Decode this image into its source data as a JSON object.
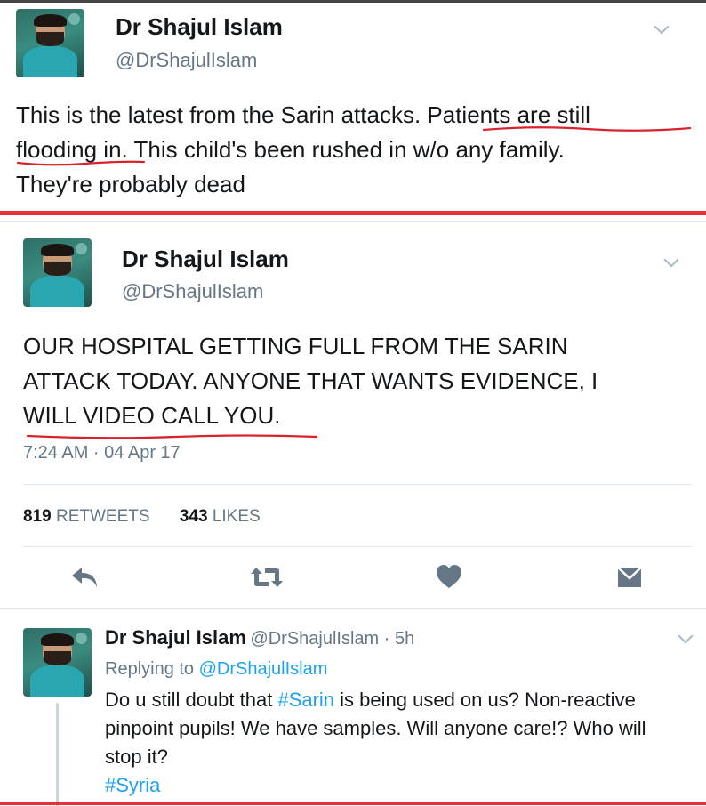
{
  "tweet1": {
    "name": "Dr Shajul Islam",
    "handle": "@DrShajulIslam",
    "text_plain_1": "This is the latest from the Sarin attacks.",
    "text_underlined": "Patients are still flooding in.",
    "text_plain_2": "This child's been rushed in w/o any family. They're probably dead",
    "line1_a": "This is the latest from the Sarin attacks. ",
    "line1_b": "Patients are still",
    "line2_a": "flooding in",
    "line2_b": ". This child's been rushed in w/o any family.",
    "line3": "They're probably dead"
  },
  "tweet2": {
    "name": "Dr Shajul Islam",
    "handle": "@DrShajulIslam",
    "line1": "OUR HOSPITAL GETTING FULL FROM THE SARIN",
    "line2": "ATTACK TODAY. ANYONE THAT WANTS EVIDENCE, I",
    "line3": "WILL VIDEO CALL YOU.",
    "timestamp": "7:24 AM · 04 Apr 17",
    "retweets_count": "819",
    "retweets_label": "RETWEETS",
    "likes_count": "343",
    "likes_label": "LIKES"
  },
  "tweet3": {
    "name": "Dr Shajul Islam",
    "handle_time": "@DrShajulIslam · 5h",
    "replying_label": "Replying to ",
    "replying_handle": "@DrShajulIslam",
    "line1_a": "Do u still doubt that ",
    "hashtag1": "#Sarin",
    "line1_b": " is being used on us? Non-reactive",
    "line2": "pinpoint pupils! We have samples. Will anyone care!? Who will",
    "line3": "stop it?",
    "hashtag2": "#Syria"
  },
  "colors": {
    "accent": "#1da1f2",
    "annotation_red": "#e8303a",
    "icon_gray": "#657786"
  },
  "icons": [
    "reply-icon",
    "retweet-icon",
    "heart-icon",
    "envelope-icon",
    "chevron-down-icon"
  ]
}
